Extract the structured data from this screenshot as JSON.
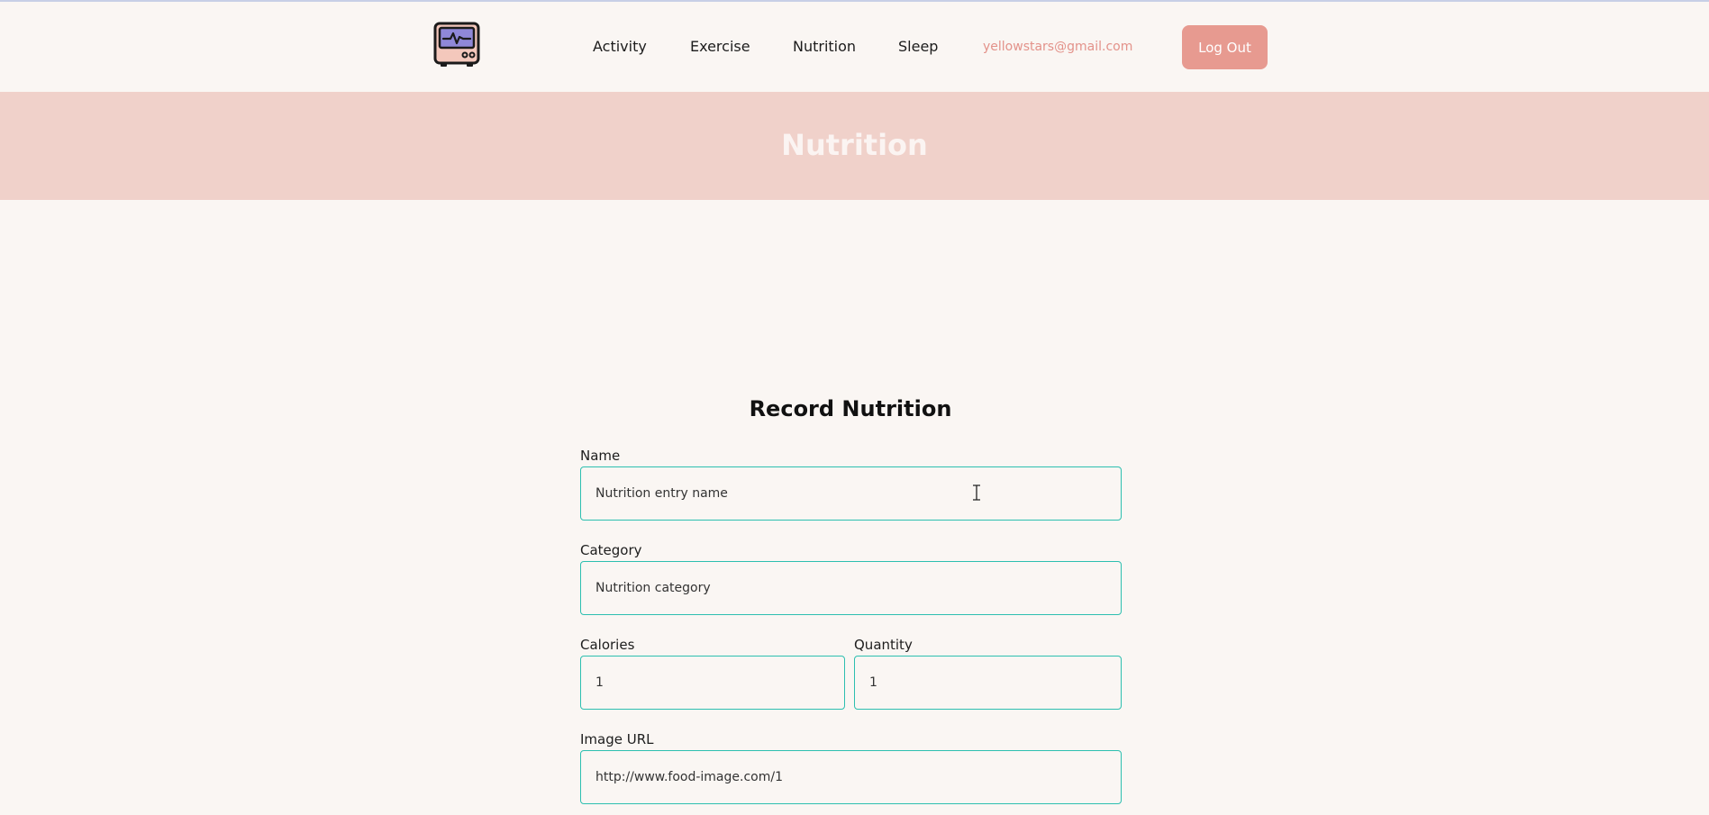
{
  "nav": {
    "logo_icon": "heart-monitor-icon",
    "links": [
      "Activity",
      "Exercise",
      "Nutrition",
      "Sleep"
    ],
    "user_email": "yellowstars@gmail.com",
    "logout_label": "Log Out"
  },
  "banner": {
    "title": "Nutrition"
  },
  "form": {
    "title": "Record Nutrition",
    "fields": {
      "name": {
        "label": "Name",
        "value": "Nutrition entry name"
      },
      "category": {
        "label": "Category",
        "value": "Nutrition category"
      },
      "calories": {
        "label": "Calories",
        "value": "1"
      },
      "quantity": {
        "label": "Quantity",
        "value": "1"
      },
      "image_url": {
        "label": "Image URL",
        "value": "http://www.food-image.com/1"
      }
    }
  },
  "colors": {
    "background": "#faf6f3",
    "banner": "#f0d1ca",
    "accent": "#e79a90",
    "input_border": "#2dbfb0"
  }
}
